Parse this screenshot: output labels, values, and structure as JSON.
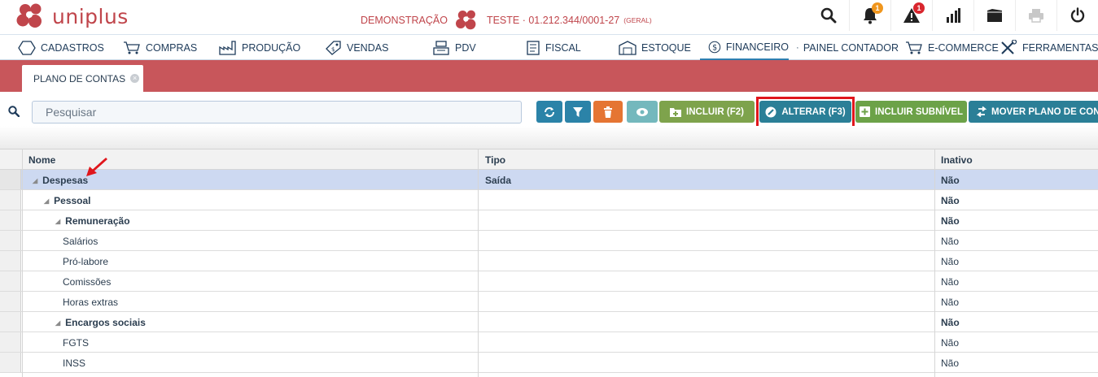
{
  "header": {
    "logo_text": "uniplus",
    "company_prefix": "DEMONSTRAÇÃO",
    "company_name": "TESTE · 01.212.344/0001-27",
    "company_scope": "(GERAL)",
    "notifications_count": "1",
    "alerts_count": "1",
    "brand_color": "#c0454b"
  },
  "menu": [
    {
      "label": "CADASTROS",
      "icon": "hexagon-icon"
    },
    {
      "label": "COMPRAS",
      "icon": "cart-icon"
    },
    {
      "label": "PRODUÇÃO",
      "icon": "factory-icon"
    },
    {
      "label": "VENDAS",
      "icon": "tag-icon"
    },
    {
      "label": "PDV",
      "icon": "register-icon"
    },
    {
      "label": "FISCAL",
      "icon": "document-icon"
    },
    {
      "label": "ESTOQUE",
      "icon": "warehouse-icon"
    },
    {
      "label": "FINANCEIRO",
      "icon": "dollar-circle-icon",
      "active": true
    },
    {
      "label": "PAINEL CONTADOR",
      "icon": "clipboard-icon"
    },
    {
      "label": "E-COMMERCE",
      "icon": "cart-icon"
    },
    {
      "label": "FERRAMENTAS",
      "icon": "tools-icon"
    }
  ],
  "tab": {
    "label": "PLANO DE CONTAS"
  },
  "search": {
    "placeholder": "Pesquisar"
  },
  "buttons": {
    "incluir": "INCLUIR (F2)",
    "alterar": "ALTERAR (F3)",
    "incluir_subnivel": "INCLUIR SUBNÍVEL",
    "mover": "MOVER PLANO DE CONTAS"
  },
  "colors": {
    "refresh": "#2b83a8",
    "filter": "#2b83a8",
    "delete": "#e57533",
    "view": "#74b8bd",
    "incluir": "#7ea34c",
    "alterar": "#2b7f97",
    "incluir_subnivel": "#6ca248",
    "mover": "#2b7f97",
    "tabbar": "#c8565b"
  },
  "grid": {
    "columns": [
      "Nome",
      "Tipo",
      "Inativo"
    ],
    "rows": [
      {
        "nome": "Despesas",
        "tipo": "Saída",
        "inativo": "Não",
        "level": 0,
        "group": true,
        "selected": true
      },
      {
        "nome": "Pessoal",
        "tipo": "",
        "inativo": "Não",
        "level": 1,
        "group": true
      },
      {
        "nome": "Remuneração",
        "tipo": "",
        "inativo": "Não",
        "level": 2,
        "group": true
      },
      {
        "nome": "Salários",
        "tipo": "",
        "inativo": "Não",
        "level": 3,
        "group": false
      },
      {
        "nome": "Pró-labore",
        "tipo": "",
        "inativo": "Não",
        "level": 3,
        "group": false
      },
      {
        "nome": "Comissões",
        "tipo": "",
        "inativo": "Não",
        "level": 3,
        "group": false
      },
      {
        "nome": "Horas extras",
        "tipo": "",
        "inativo": "Não",
        "level": 3,
        "group": false
      },
      {
        "nome": "Encargos sociais",
        "tipo": "",
        "inativo": "Não",
        "level": 2,
        "group": true
      },
      {
        "nome": "FGTS",
        "tipo": "",
        "inativo": "Não",
        "level": 3,
        "group": false
      },
      {
        "nome": "INSS",
        "tipo": "",
        "inativo": "Não",
        "level": 3,
        "group": false
      }
    ]
  }
}
